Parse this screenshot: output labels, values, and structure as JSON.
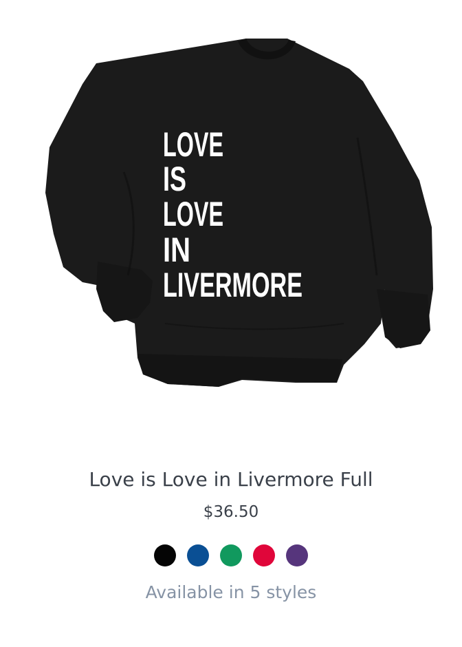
{
  "product": {
    "image_name": "black-crewneck-sweatshirt",
    "print_lines": [
      "LOVE",
      "IS",
      "LOVE",
      "IN",
      "LIVERMORE"
    ],
    "title": "Love is Love in Livermore Full",
    "price": "$36.50",
    "availability": "Available in 5 styles",
    "swatches": [
      {
        "name": "black",
        "color": "#050505"
      },
      {
        "name": "blue",
        "color": "#0a4f94"
      },
      {
        "name": "green",
        "color": "#11995e"
      },
      {
        "name": "red",
        "color": "#e0063a"
      },
      {
        "name": "purple",
        "color": "#56357c"
      }
    ]
  }
}
